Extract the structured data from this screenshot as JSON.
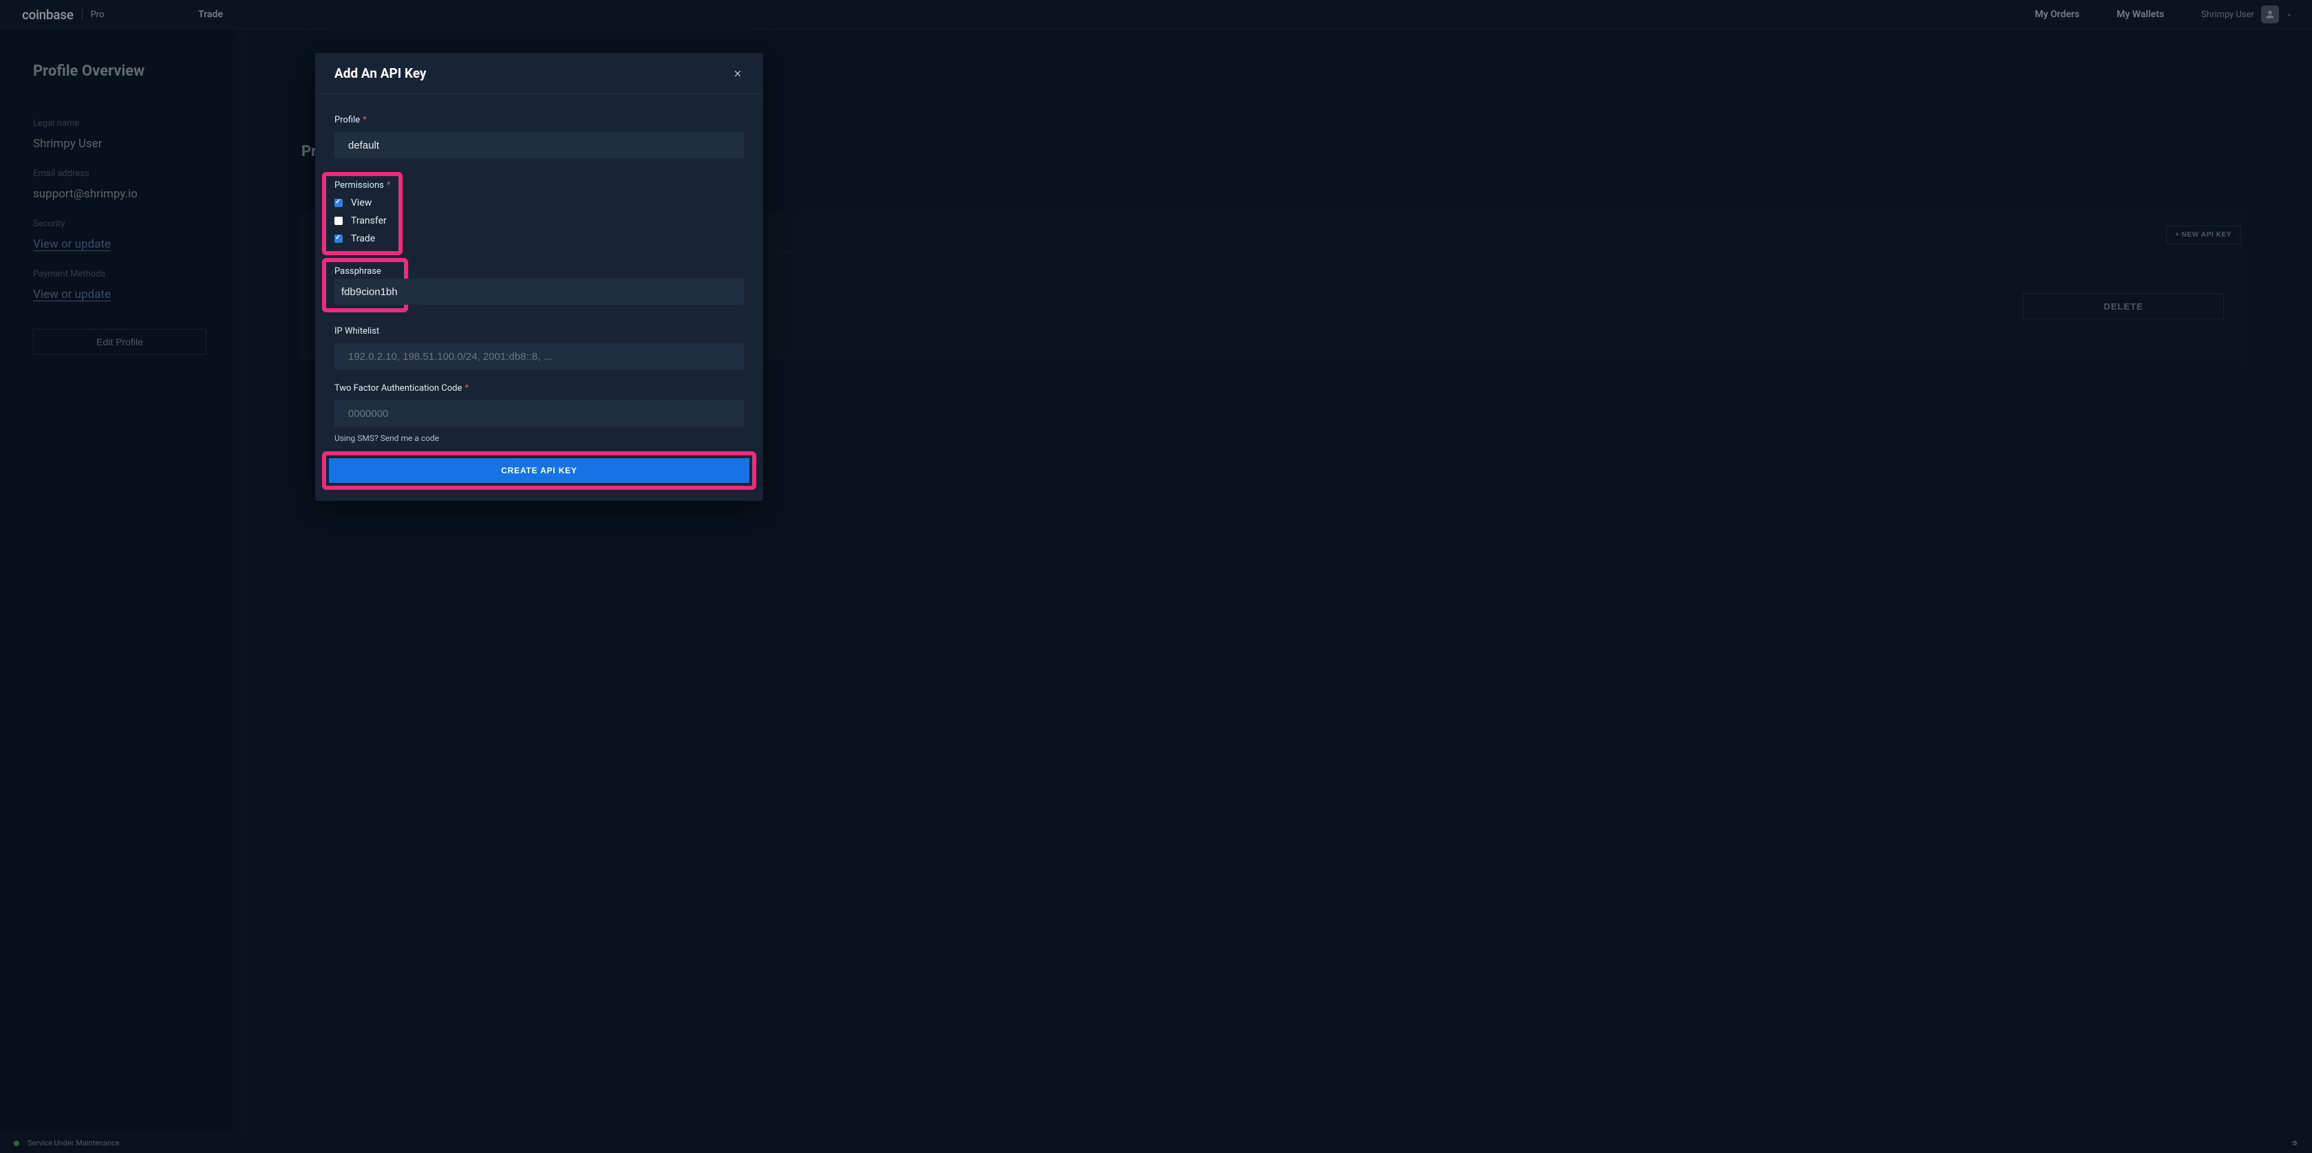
{
  "topbar": {
    "brand_word": "coinbase",
    "brand_sub": "Pro",
    "trade": "Trade",
    "my_orders": "My Orders",
    "my_wallets": "My Wallets",
    "username": "Shrimpy User"
  },
  "sidebar": {
    "title": "Profile Overview",
    "legal_name_label": "Legal name",
    "legal_name": "Shrimpy User",
    "email_label": "Email address",
    "email": "support@shrimpy.io",
    "security_label": "Security",
    "security_link": "View or update",
    "payment_label": "Payment Methods",
    "payment_link": "View or update",
    "edit_btn": "Edit Profile"
  },
  "main": {
    "heading_truncated": "Pr",
    "new_api_btn": "+ NEW API KEY",
    "delete_btn": "DELETE"
  },
  "status": {
    "text": "Service Under Maintenance"
  },
  "modal": {
    "title": "Add An API Key",
    "profile_label": "Profile",
    "profile_value": "default",
    "permissions_label": "Permissions",
    "perm_view": "View",
    "perm_transfer": "Transfer",
    "perm_trade": "Trade",
    "passphrase_label": "Passphrase",
    "passphrase_value": "fdb9cion1bh",
    "ip_label": "IP Whitelist",
    "ip_placeholder": "192.0.2.10, 198.51.100.0/24, 2001:db8::8, ...",
    "tfa_label": "Two Factor Authentication Code",
    "tfa_placeholder": "0000000",
    "sms_hint": "Using SMS? Send me a code",
    "create_btn": "CREATE API KEY"
  },
  "permissions": {
    "view": true,
    "transfer": false,
    "trade": true
  }
}
